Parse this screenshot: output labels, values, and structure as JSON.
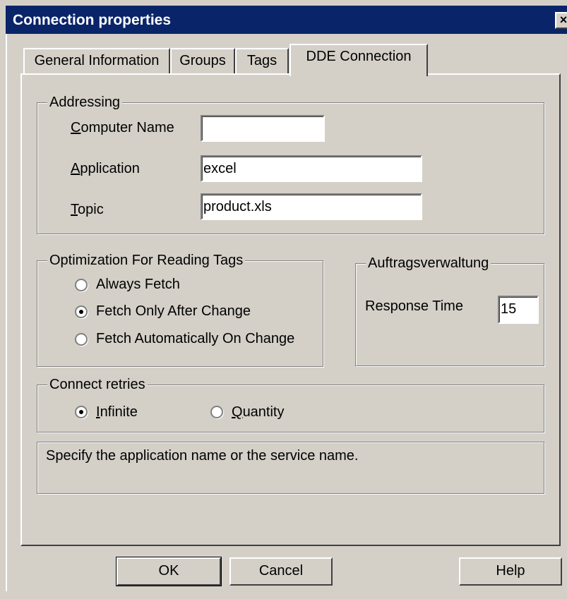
{
  "window": {
    "title": "Connection properties",
    "close_glyph": "×"
  },
  "tabs": [
    {
      "label": "General Information",
      "active": false
    },
    {
      "label": "Groups",
      "active": false
    },
    {
      "label": "Tags",
      "active": false
    },
    {
      "label": "DDE Connection",
      "active": true
    }
  ],
  "addressing": {
    "legend": "Addressing",
    "computer_name": {
      "mnemonic": "C",
      "rest": "omputer Name",
      "value": ""
    },
    "application": {
      "mnemonic": "A",
      "rest": "pplication",
      "value": "excel"
    },
    "topic": {
      "mnemonic": "T",
      "rest": "opic",
      "value": "product.xls"
    }
  },
  "optimization": {
    "legend": "Optimization For Reading Tags",
    "options": [
      {
        "label": "Always Fetch",
        "selected": false
      },
      {
        "label": "Fetch Only After Change",
        "selected": true
      },
      {
        "label": "Fetch Automatically On Change",
        "selected": false
      }
    ]
  },
  "auftrags": {
    "legend": "Auftragsverwaltung",
    "response_label": "Response Time",
    "response_value": "15"
  },
  "retries": {
    "legend": "Connect retries",
    "infinite": {
      "mnemonic": "I",
      "rest": "nfinite",
      "selected": true
    },
    "quantity": {
      "mnemonic": "Q",
      "rest": "uantity",
      "selected": false
    }
  },
  "status_text": "Specify the application name or the service name.",
  "buttons": {
    "ok": "OK",
    "cancel": "Cancel",
    "help": "Help"
  }
}
